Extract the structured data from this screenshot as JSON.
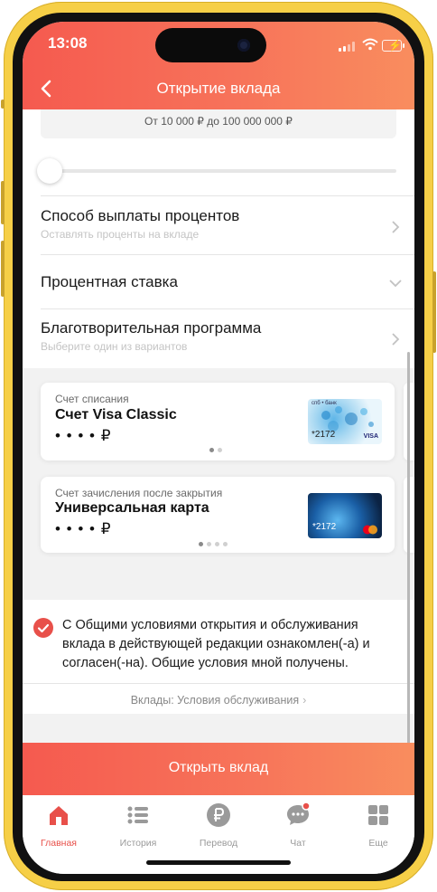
{
  "status_bar": {
    "time": "13:08"
  },
  "nav": {
    "title": "Открытие вклада"
  },
  "amount": {
    "range_hint": "От 10 000 ₽ до 100 000 000 ₽"
  },
  "rows": {
    "payout": {
      "title": "Способ выплаты процентов",
      "subtitle": "Оставлять проценты на вкладе"
    },
    "rate": {
      "title": "Процентная ставка"
    },
    "charity": {
      "title": "Благотворительная программа",
      "subtitle": "Выберите один из вариантов"
    }
  },
  "debit_card": {
    "label": "Счет списания",
    "name": "Счет Visa Classic",
    "balance": "• • • • ₽",
    "card_number": "*2172",
    "card_brand": "VISA",
    "bank_mark": "спб • банк"
  },
  "credit_card": {
    "label": "Счет зачисления после закрытия",
    "name": "Универсальная карта",
    "balance": "• • • • ₽",
    "card_number": "*2172"
  },
  "agreement": {
    "text": "С Общими условиями открытия и обслуживания вклада в действующей редакции ознакомлен(-а) и согласен(-на). Общие условия мной получены.",
    "checked": true
  },
  "terms_link": {
    "label": "Вклады: Условия обслуживания"
  },
  "cta": {
    "label": "Открыть вклад"
  },
  "tabs": [
    {
      "label": "Главная",
      "icon": "home-icon"
    },
    {
      "label": "История",
      "icon": "list-icon"
    },
    {
      "label": "Перевод",
      "icon": "ruble-icon"
    },
    {
      "label": "Чат",
      "icon": "chat-icon"
    },
    {
      "label": "Еще",
      "icon": "grid-icon"
    }
  ],
  "colors": {
    "accent": "#e8504a",
    "gradient_start": "#f55a4f",
    "gradient_end": "#f98d5e",
    "frame": "#f6cf47"
  }
}
